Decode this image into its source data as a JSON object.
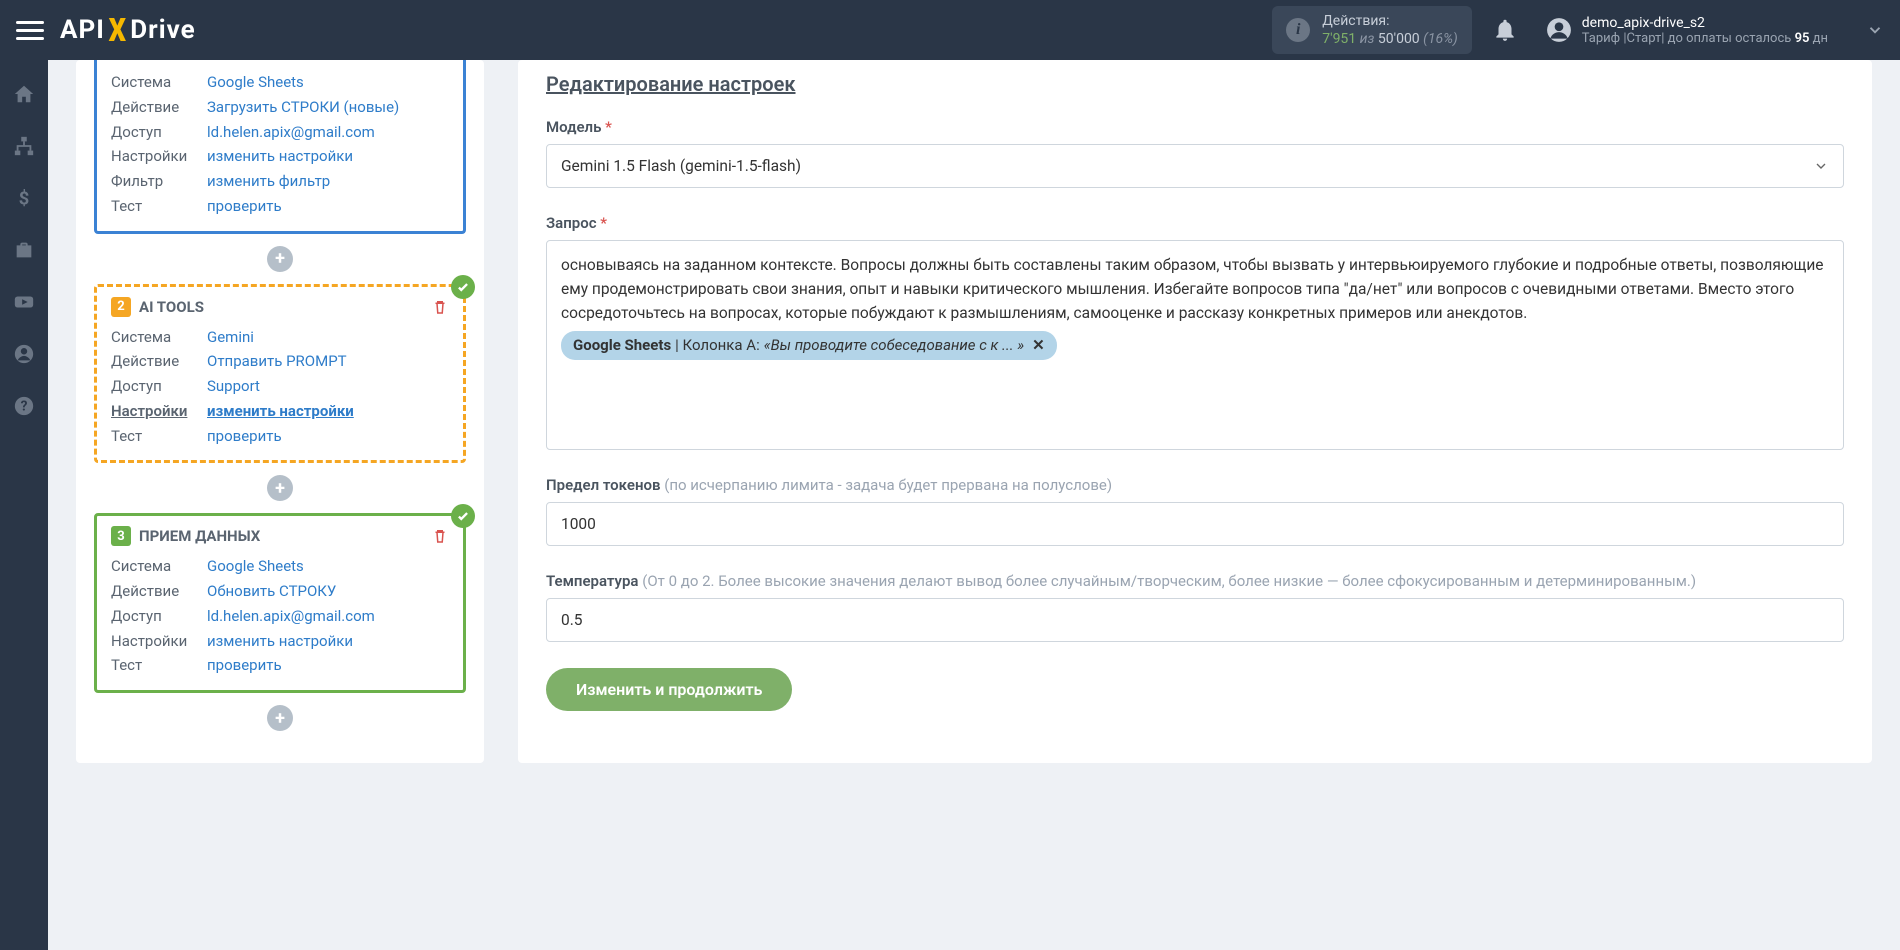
{
  "top": {
    "actions_label": "Действия:",
    "actions_used": "7'951",
    "actions_of": "из",
    "actions_total": "50'000",
    "actions_pct": "(16%)",
    "username": "demo_apix-drive_s2",
    "tariff_prefix": "Тариф |Старт| до оплаты осталось ",
    "tariff_days": "95",
    "tariff_suffix": " дн"
  },
  "labels": {
    "system": "Система",
    "action": "Действие",
    "access": "Доступ",
    "settings": "Настройки",
    "filter": "Фильтр",
    "test": "Тест"
  },
  "card1": {
    "system": "Google Sheets",
    "action": "Загрузить СТРОКИ (новые)",
    "access": "ld.helen.apix@gmail.com",
    "settings": "изменить настройки",
    "filter": "изменить фильтр",
    "test": "проверить"
  },
  "card2": {
    "title": "AI TOOLS",
    "num": "2",
    "system": "Gemini",
    "action": "Отправить PROMPT",
    "access": "Support",
    "settings": "изменить настройки",
    "test": "проверить"
  },
  "card3": {
    "title": "ПРИЕМ ДАННЫХ",
    "num": "3",
    "system": "Google Sheets",
    "action": "Обновить СТРОКУ",
    "access": "ld.helen.apix@gmail.com",
    "settings": "изменить настройки",
    "test": "проверить"
  },
  "form": {
    "heading": "Редактирование настроек",
    "model_label": "Модель",
    "model_value": "Gemini 1.5 Flash (gemini-1.5-flash)",
    "query_label": "Запрос",
    "query_text": "основываясь на заданном контексте. Вопросы должны быть составлены таким образом, чтобы вызвать у интервьюируемого глубокие и подробные ответы, позволяющие ему продемонстрировать свои знания, опыт и навыки критического мышления. Избегайте вопросов типа \"да/нет\" или вопросов с очевидными ответами. Вместо этого сосредоточьтесь на вопросах, которые побуждают к размышлениям, самооценке и рассказу конкретных примеров или анекдотов.",
    "tag_source": "Google Sheets",
    "tag_col": " | Колонка A: ",
    "tag_sample": "«Вы проводите собеседование с к ... »",
    "tokens_label": "Предел токенов",
    "tokens_hint": " (по исчерпанию лимита - задача будет прервана на полуслове)",
    "tokens_value": "1000",
    "temp_label": "Температура",
    "temp_hint": " (От 0 до 2. Более высокие значения делают вывод более случайным/творческим, более низкие — более сфокусированным и детерминированным.)",
    "temp_value": "0.5",
    "submit": "Изменить и продолжить"
  }
}
